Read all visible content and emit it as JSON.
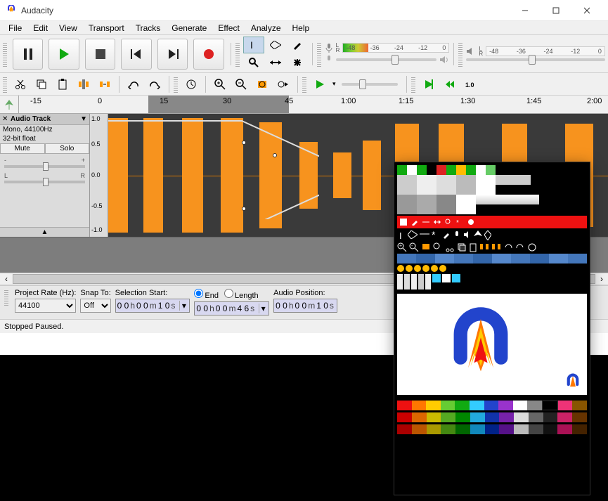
{
  "window": {
    "title": "Audacity"
  },
  "menu": [
    "File",
    "Edit",
    "View",
    "Transport",
    "Tracks",
    "Generate",
    "Effect",
    "Analyze",
    "Help"
  ],
  "meter": {
    "ticks": [
      "-48",
      "-36",
      "-24",
      "-12",
      "0"
    ],
    "labels": [
      "L",
      "R"
    ]
  },
  "timeline": {
    "ticks": [
      {
        "pos": 36,
        "label": "-15"
      },
      {
        "pos": 130,
        "label": "0"
      },
      {
        "pos": 216,
        "label": "15"
      },
      {
        "pos": 308,
        "label": "30"
      },
      {
        "pos": 396,
        "label": "45"
      },
      {
        "pos": 478,
        "label": "1:00"
      },
      {
        "pos": 560,
        "label": "1:15"
      },
      {
        "pos": 648,
        "label": "1:30"
      },
      {
        "pos": 744,
        "label": "1:45"
      },
      {
        "pos": 830,
        "label": "2:00"
      }
    ]
  },
  "track": {
    "menu_label": "Audio Track",
    "info1": "Mono, 44100Hz",
    "info2": "32-bit float",
    "mute": "Mute",
    "solo": "Solo",
    "gain": {
      "l": "-",
      "r": "+"
    },
    "pan": {
      "l": "L",
      "r": "R"
    },
    "amp": [
      "1.0",
      "0.5",
      "0.0",
      "-0.5",
      "-1.0"
    ]
  },
  "selbar": {
    "rate_label": "Project Rate (Hz):",
    "rate_value": "44100",
    "snap_label": "Snap To:",
    "snap_value": "Off",
    "selstart_label": "Selection Start:",
    "end_label": "End",
    "length_label": "Length",
    "audiopos_label": "Audio Position:",
    "tc_start": {
      "h": "0 0",
      "m": "0 0",
      "s": "1 0"
    },
    "tc_end": {
      "h": "0 0",
      "m": "0 0",
      "s": "4 6"
    },
    "tc_pos": {
      "h": "0 0",
      "m": "0 0",
      "s": "1 0"
    }
  },
  "status": "Stopped Paused."
}
